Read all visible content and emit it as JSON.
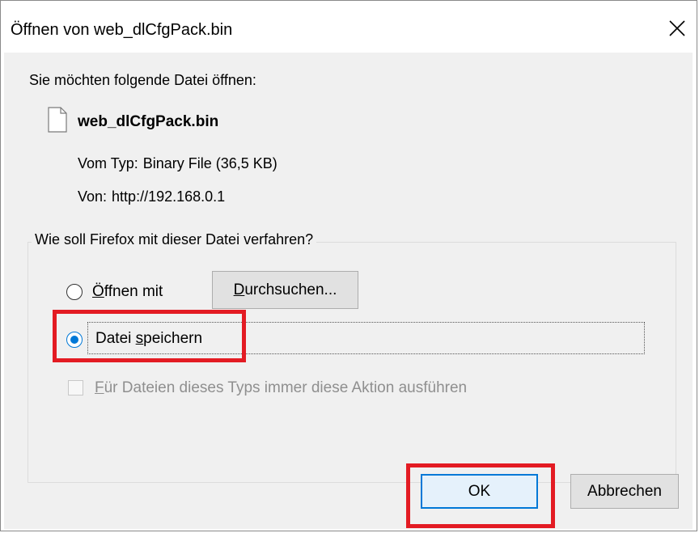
{
  "dialog": {
    "title": "Öffnen von web_dlCfgPack.bin",
    "close_icon": "close-icon",
    "prompt": "Sie möchten folgende Datei öffnen:",
    "file_icon": "file-icon",
    "file_name": "web_dlCfgPack.bin",
    "type_label": "Vom Typ:",
    "type_value": "Binary File (36,5 KB)",
    "from_label": "Von:",
    "from_value": "http://192.168.0.1"
  },
  "action_group": {
    "legend": "Wie soll Firefox mit dieser Datei verfahren?",
    "open_with": {
      "label_underlined": "Ö",
      "label_rest": "ffnen mit",
      "checked": false
    },
    "browse_button": {
      "label_underlined": "D",
      "label_rest": "urchsuchen..."
    },
    "save_file": {
      "label_before": "Datei ",
      "label_underlined": "s",
      "label_rest": "peichern",
      "checked": true
    },
    "always_do": {
      "label_underlined": "F",
      "label_rest": "ür Dateien dieses Typs immer diese Aktion ausführen",
      "checked": false,
      "enabled": false
    }
  },
  "buttons": {
    "ok": "OK",
    "cancel": "Abbrechen"
  },
  "annotation_color": "#e31b23",
  "accent_color": "#0078d7"
}
